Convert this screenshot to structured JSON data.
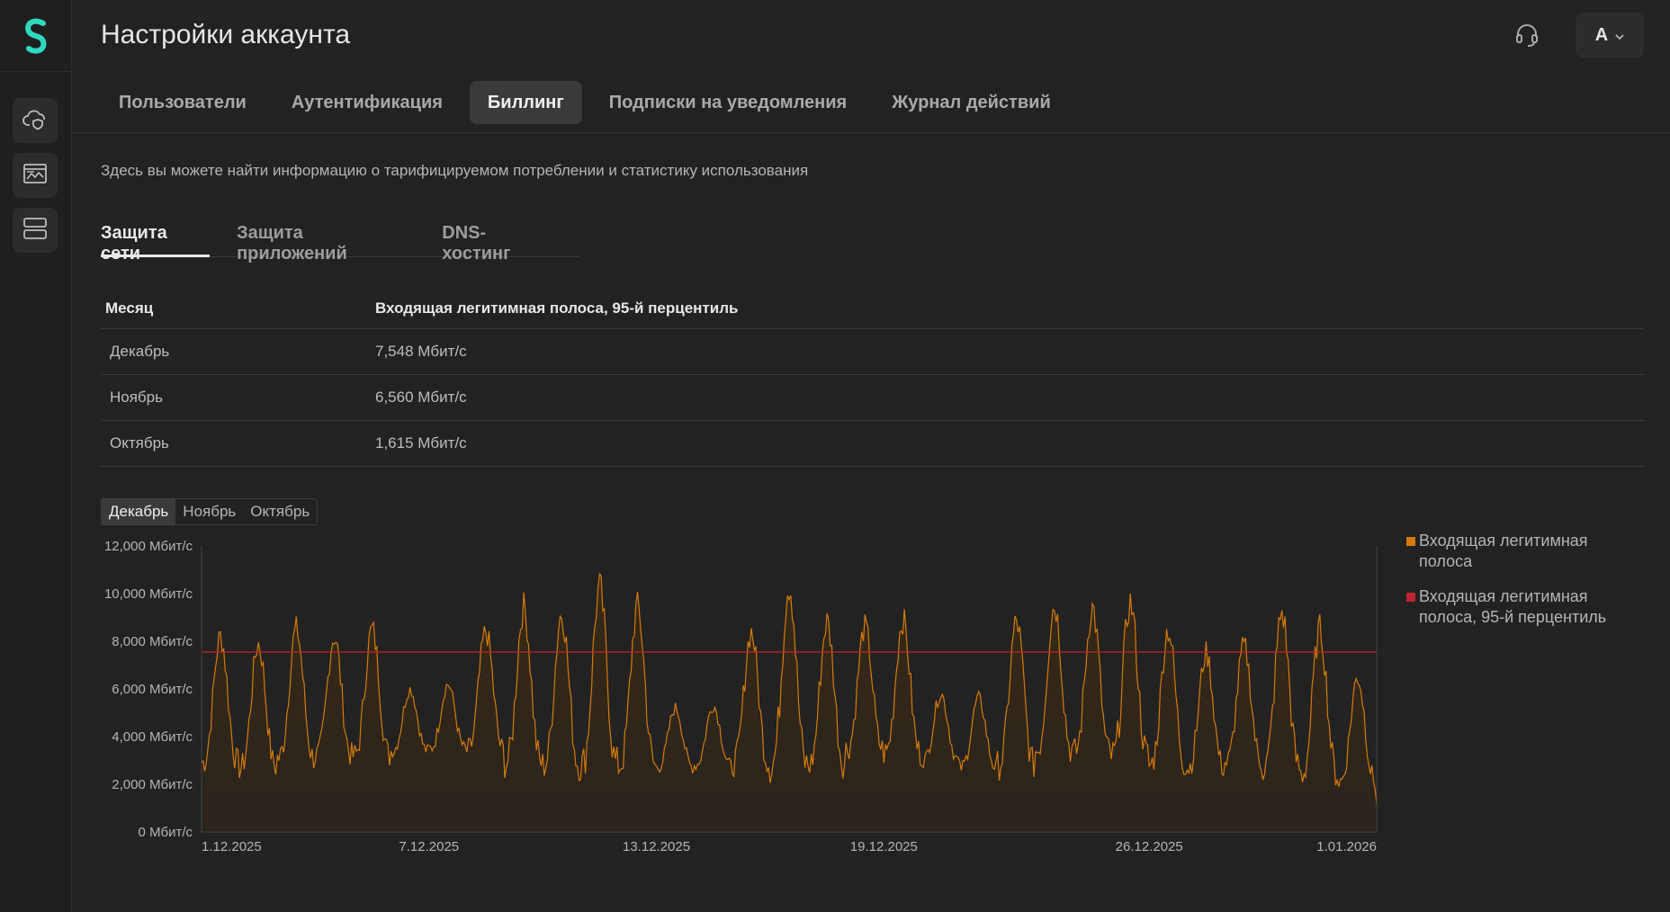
{
  "header": {
    "title": "Настройки аккаунта",
    "avatar_letter": "А"
  },
  "tabs": [
    {
      "label": "Пользователи",
      "active": false
    },
    {
      "label": "Аутентификация",
      "active": false
    },
    {
      "label": "Биллинг",
      "active": true
    },
    {
      "label": "Подписки на уведомления",
      "active": false
    },
    {
      "label": "Журнал действий",
      "active": false
    }
  ],
  "description": "Здесь вы можете найти информацию о тарифицируемом потреблении и статистику использования",
  "sub_tabs": [
    {
      "label": "Защита сети",
      "active": true
    },
    {
      "label": "Защита приложений",
      "active": false
    },
    {
      "label": "DNS-хостинг",
      "active": false
    }
  ],
  "table": {
    "headers": [
      "Месяц",
      "Входящая легитимная полоса, 95-й перцентиль"
    ],
    "rows": [
      [
        "Декабрь",
        "7,548 Мбит/с"
      ],
      [
        "Ноябрь",
        "6,560 Мбит/с"
      ],
      [
        "Октябрь",
        "1,615 Мбит/с"
      ]
    ]
  },
  "month_selector": {
    "options": [
      "Декабрь",
      "Ноябрь",
      "Октябрь"
    ],
    "selected": "Декабрь"
  },
  "colors": {
    "accent": "#2fd9c0",
    "series_bandwidth": "#d67a0c",
    "series_percentile": "#c0242c"
  },
  "icons": [
    "logo-icon",
    "cloud-shield-icon",
    "browser-chart-icon",
    "server-icon",
    "headset-icon",
    "chevron-down-icon"
  ],
  "chart_data": {
    "type": "line",
    "y_ticks": [
      "0 Мбит/с",
      "2,000 Мбит/с",
      "4,000 Мбит/с",
      "6,000 Мбит/с",
      "8,000 Мбит/с",
      "10,000 Мбит/с",
      "12,000 Мбит/с"
    ],
    "x_ticks": [
      "1.12.2025",
      "7.12.2025",
      "13.12.2025",
      "19.12.2025",
      "26.12.2025",
      "1.01.2026"
    ],
    "ylim": [
      0,
      12000
    ],
    "xlim": [
      "2025-12-01",
      "2026-01-01"
    ],
    "grid": false,
    "legend_position": "right",
    "series": [
      {
        "name": "Входящая легитимная полоса",
        "color": "#d67a0c",
        "x": [
          "2025-12-01",
          "2025-12-02",
          "2025-12-03",
          "2025-12-04",
          "2025-12-05",
          "2025-12-06",
          "2025-12-07",
          "2025-12-08",
          "2025-12-09",
          "2025-12-10",
          "2025-12-11",
          "2025-12-12",
          "2025-12-13",
          "2025-12-14",
          "2025-12-15",
          "2025-12-16",
          "2025-12-17",
          "2025-12-18",
          "2025-12-19",
          "2025-12-20",
          "2025-12-21",
          "2025-12-22",
          "2025-12-23",
          "2025-12-24",
          "2025-12-25",
          "2025-12-26",
          "2025-12-27",
          "2025-12-28",
          "2025-12-29",
          "2025-12-30",
          "2025-12-31",
          "2026-01-01"
        ],
        "daily_peaks": [
          8200,
          7900,
          8500,
          8200,
          8500,
          6000,
          6200,
          8400,
          9400,
          9200,
          10200,
          9400,
          5200,
          5300,
          8400,
          10400,
          8800,
          8600,
          8900,
          5800,
          5600,
          8800,
          9500,
          9400,
          9600,
          8500,
          7500,
          7800,
          9200,
          8500,
          6500,
          5700
        ],
        "daily_lows": [
          2900,
          2700,
          3100,
          3200,
          3200,
          3400,
          3500,
          3400,
          2900,
          2800,
          2800,
          2800,
          2700,
          2800,
          2900,
          2800,
          2800,
          3500,
          3300,
          3000,
          2700,
          2800,
          3400,
          3300,
          3200,
          2800,
          2700,
          2900,
          2700,
          2400,
          2100,
          1200
        ]
      },
      {
        "name": "Входящая легитимная полоса, 95-й перцентиль",
        "color": "#c0242c",
        "value": 7548
      }
    ]
  }
}
